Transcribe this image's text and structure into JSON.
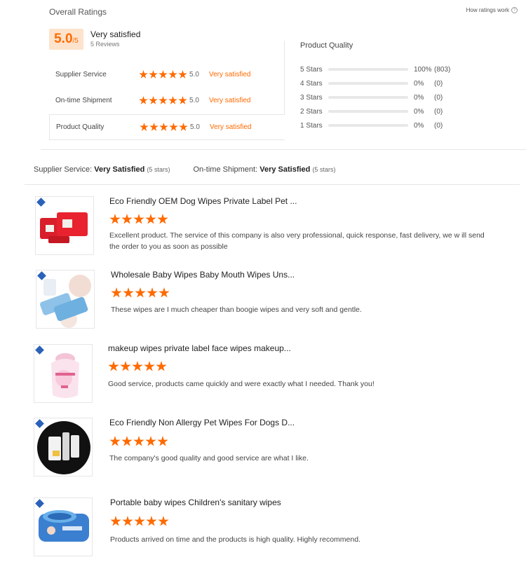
{
  "header": {
    "overall_title": "Overall Ratings",
    "how_ratings_link": "How ratings work",
    "score_big": "5.0",
    "score_small": "/5",
    "score_label": "Very satisfied",
    "reviews_count": "5 Reviews"
  },
  "sub_ratings": [
    {
      "label": "Supplier Service",
      "score": "5.0",
      "word": "Very satisfied",
      "stars": 5
    },
    {
      "label": "On-time Shipment",
      "score": "5.0",
      "word": "Very satisfied",
      "stars": 5
    },
    {
      "label": "Product Quality",
      "score": "5.0",
      "word": "Very satisfied",
      "stars": 5
    }
  ],
  "product_quality": {
    "title": "Product Quality",
    "rows": [
      {
        "label": "5  Stars",
        "pct": "100%",
        "count": "(803)",
        "fill": 1.0
      },
      {
        "label": "4  Stars",
        "pct": "0%",
        "count": "(0)",
        "fill": 0
      },
      {
        "label": "3  Stars",
        "pct": "0%",
        "count": "(0)",
        "fill": 0
      },
      {
        "label": "2  Stars",
        "pct": "0%",
        "count": "(0)",
        "fill": 0
      },
      {
        "label": "1  Stars",
        "pct": "0%",
        "count": "(0)",
        "fill": 0
      }
    ]
  },
  "summary": {
    "supplier_label": "Supplier Service:",
    "supplier_value": "Very Satisfied",
    "supplier_stars": "(5 stars)",
    "shipment_label": "On-time Shipment:",
    "shipment_value": "Very Satisfied",
    "shipment_stars": "(5 stars)"
  },
  "reviews": [
    {
      "title": "Eco Friendly OEM Dog Wipes Private Label Pet ...",
      "rating": 5,
      "text": "Excellent product. The service of this company is also very professional, quick response, fast delivery, we w ill send the order to you as soon as possible",
      "thumb": "red-dog-wipes-packs"
    },
    {
      "title": "Wholesale Baby Wipes Baby Mouth Wipes Uns...",
      "rating": 5,
      "text": "These wipes are I much cheaper than boogie wipes and very soft and gentle.",
      "thumb": "baby-mouth-wipes"
    },
    {
      "title": "makeup wipes private label face wipes makeup...",
      "rating": 5,
      "text": "Good service, products came quickly and were exactly what I needed. Thank you!",
      "thumb": "makeup-wipes-bag"
    },
    {
      "title": "Eco Friendly Non Allergy Pet Wipes For Dogs D...",
      "rating": 5,
      "text": "The company's good quality and good service are what I like.",
      "thumb": "pet-wipes-circle"
    },
    {
      "title": "Portable baby wipes Children's sanitary wipes",
      "rating": 5,
      "text": "Products arrived on time and the products is high quality. Highly recommend.",
      "thumb": "portable-baby-wipes"
    }
  ],
  "colors": {
    "accent": "#ff6a00",
    "accent_light": "#fde3cc",
    "divider": "#e6e6e6"
  }
}
